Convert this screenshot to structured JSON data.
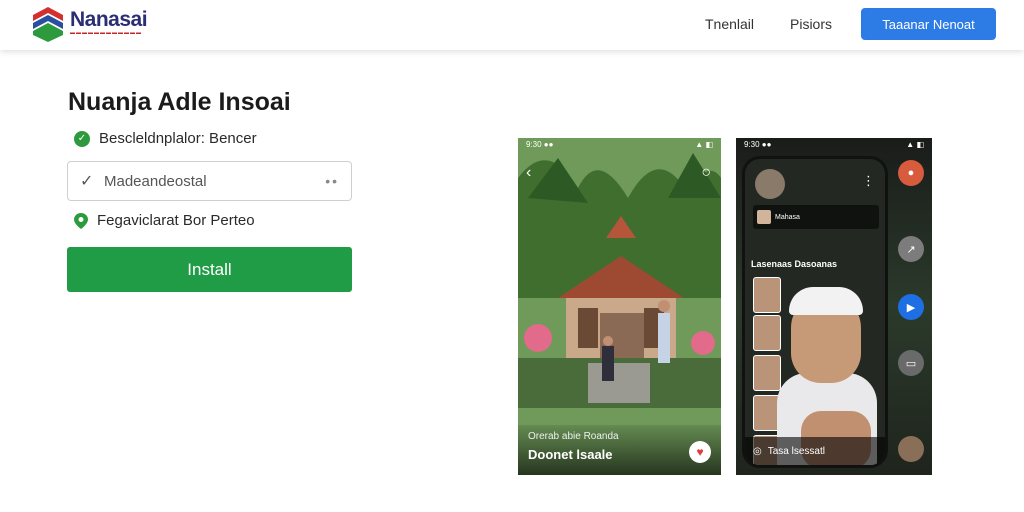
{
  "header": {
    "brand_name": "Nanasai",
    "brand_tagline": "▬▬▬▬▬▬▬▬▬▬▬▬",
    "nav": [
      "Tnenlail",
      "Pisiors"
    ],
    "cta_label": "Taaanar Nenoat"
  },
  "main": {
    "title": "Nuanja Adle Insoai",
    "check_text": "Bescleldnplalor: Bencer",
    "input_value": "Madeandeostal",
    "input_check": "✓",
    "input_dots": "••",
    "pin_text": "Fegaviclarat Bor Perteo",
    "install_label": "Install"
  },
  "shots": {
    "one": {
      "status_time": "9:30 ●●",
      "status_icons": "▲ ◧",
      "caption_small": "Orerab abie Roanda",
      "caption_big": "Doonet lsaale"
    },
    "two": {
      "status_time": "9:30 ●●",
      "status_icons": "▲ ◧",
      "chat_text": "Mahasa",
      "live_label": "Lasenaas Dasoanas",
      "bottom_text": "Tasa lsessatl"
    }
  },
  "colors": {
    "accent_blue": "#2d7be5",
    "install_green": "#1f9c45",
    "brand_navy": "#2a2e73",
    "check_green": "#2e9a3e"
  }
}
